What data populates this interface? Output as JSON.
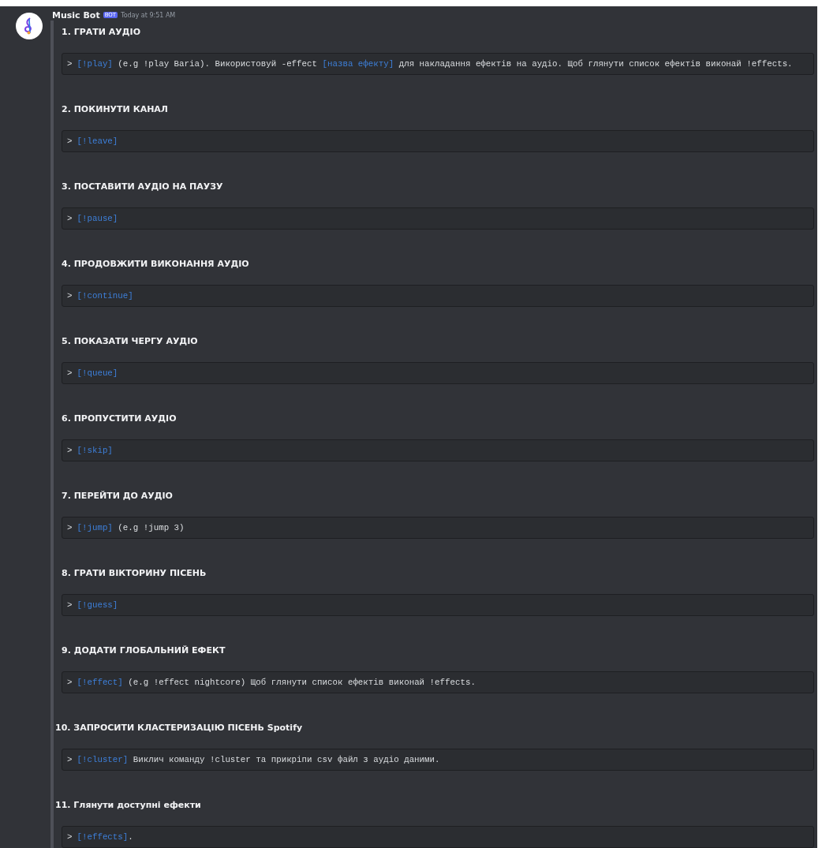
{
  "message": {
    "author": "Music Bot",
    "badge": "BOT",
    "timestamp": "Today at 9:51 AM"
  },
  "sections": [
    {
      "heading": "1. ГРАТИ АУДІО",
      "prompt": ">",
      "segments": [
        {
          "kind": "link",
          "text": "[!play]"
        },
        {
          "kind": "plain",
          "text": " (e.g !play Baria). Використовуй -effect "
        },
        {
          "kind": "link",
          "text": "[назва ефекту]"
        },
        {
          "kind": "plain",
          "text": " для накладання ефектів на аудіо. Щоб глянути список ефектів виконай !effects."
        }
      ]
    },
    {
      "heading": "2. ПОКИНУТИ КАНАЛ",
      "prompt": ">",
      "segments": [
        {
          "kind": "link",
          "text": "[!leave]"
        }
      ]
    },
    {
      "heading": "3. ПОСТАВИТИ АУДІО НА ПАУЗУ",
      "prompt": ">",
      "segments": [
        {
          "kind": "link",
          "text": "[!pause]"
        }
      ]
    },
    {
      "heading": "4. ПРОДОВЖИТИ ВИКОНАННЯ АУДІО",
      "prompt": ">",
      "segments": [
        {
          "kind": "link",
          "text": "[!continue]"
        }
      ]
    },
    {
      "heading": "5. ПОКАЗАТИ ЧЕРГУ АУДІО",
      "prompt": ">",
      "segments": [
        {
          "kind": "link",
          "text": "[!queue]"
        }
      ]
    },
    {
      "heading": "6. ПРОПУСТИТИ АУДІО",
      "prompt": ">",
      "segments": [
        {
          "kind": "link",
          "text": "[!skip]"
        }
      ]
    },
    {
      "heading": "7. ПЕРЕЙТИ ДО АУДІО",
      "prompt": ">",
      "segments": [
        {
          "kind": "link",
          "text": "[!jump]"
        },
        {
          "kind": "plain",
          "text": " (e.g !jump 3)"
        }
      ]
    },
    {
      "heading": "8. ГРАТИ ВІКТОРИНУ ПІСЕНЬ",
      "prompt": ">",
      "segments": [
        {
          "kind": "link",
          "text": "[!guess]"
        }
      ]
    },
    {
      "heading": "9. ДОДАТИ ГЛОБАЛЬНИЙ ЕФЕКТ",
      "prompt": ">",
      "segments": [
        {
          "kind": "link",
          "text": "[!effect]"
        },
        {
          "kind": "plain",
          "text": " (e.g !effect nightcore) Щоб глянути список ефектів виконай !effects."
        }
      ]
    },
    {
      "heading": "10. ЗАПРОСИТИ КЛАСТЕРИЗАЦІЮ ПІСЕНЬ Spotify",
      "prompt": ">",
      "segments": [
        {
          "kind": "link",
          "text": "[!cluster]"
        },
        {
          "kind": "plain",
          "text": " Виклич команду !cluster та прикріпи csv файл з аудіо даними."
        }
      ]
    },
    {
      "heading": "11. Глянути доступні ефекти",
      "prompt": ">",
      "segments": [
        {
          "kind": "link",
          "text": "[!effects]"
        },
        {
          "kind": "plain",
          "text": "."
        }
      ]
    }
  ]
}
